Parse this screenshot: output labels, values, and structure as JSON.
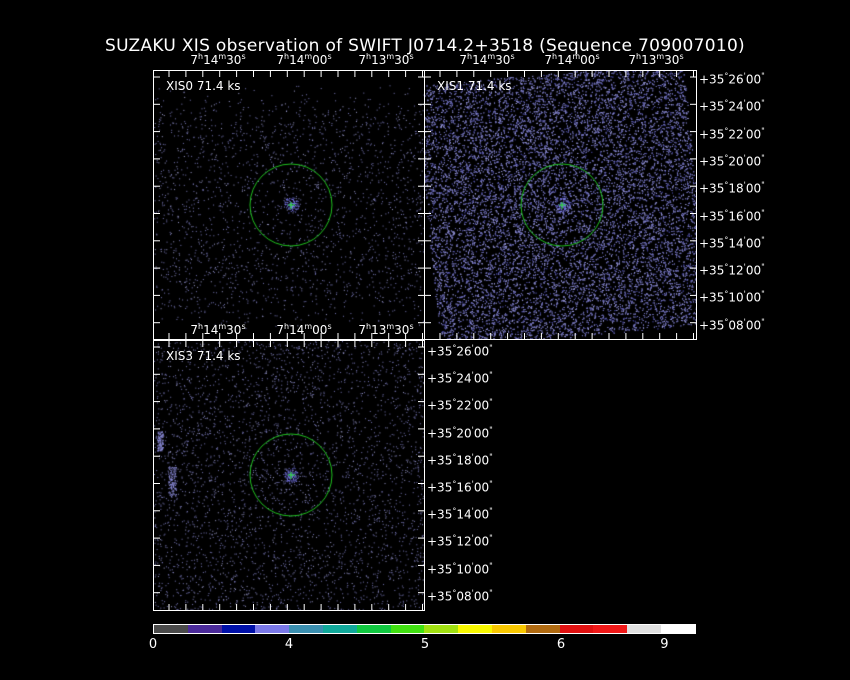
{
  "title": "SUZAKU XIS observation of SWIFT J0714.2+3518  (Sequence 709007010)",
  "panels": [
    {
      "id": "xis0",
      "label": "XIS0 71.4 ks",
      "density": "low",
      "has_ra_labels": true,
      "has_dec_labels": false
    },
    {
      "id": "xis1",
      "label": "XIS1 71.4 ks",
      "density": "high",
      "has_ra_labels": true,
      "has_dec_labels": true
    },
    {
      "id": "xis3",
      "label": "XIS3 71.4 ks",
      "density": "low",
      "has_ra_labels": false,
      "has_dec_labels": true
    }
  ],
  "ra_labels": [
    {
      "h": "7",
      "m": "14",
      "s": "30"
    },
    {
      "h": "7",
      "m": "14",
      "s": "00"
    },
    {
      "h": "7",
      "m": "13",
      "s": "30"
    }
  ],
  "dec_labels": [
    {
      "deg": "+35",
      "min": "26",
      "sec": "00"
    },
    {
      "deg": "+35",
      "min": "24",
      "sec": "00"
    },
    {
      "deg": "+35",
      "min": "22",
      "sec": "00"
    },
    {
      "deg": "+35",
      "min": "20",
      "sec": "00"
    },
    {
      "deg": "+35",
      "min": "18",
      "sec": "00"
    },
    {
      "deg": "+35",
      "min": "16",
      "sec": "00"
    },
    {
      "deg": "+35",
      "min": "14",
      "sec": "00"
    },
    {
      "deg": "+35",
      "min": "12",
      "sec": "00"
    },
    {
      "deg": "+35",
      "min": "10",
      "sec": "00"
    },
    {
      "deg": "+35",
      "min": "08",
      "sec": "00"
    }
  ],
  "colorbar": {
    "colors": [
      "#4a4a4a",
      "#4b2a9a",
      "#0010a8",
      "#7a78e8",
      "#3a8fb0",
      "#10a89a",
      "#10c840",
      "#40e010",
      "#a0e010",
      "#f8f800",
      "#f8c800",
      "#b06a10",
      "#e01010",
      "#f01818",
      "#e0e0e0",
      "#ffffff"
    ],
    "labels": [
      {
        "text": "0",
        "frac": 0.0
      },
      {
        "text": "4",
        "frac": 0.25
      },
      {
        "text": "5",
        "frac": 0.5
      },
      {
        "text": "6",
        "frac": 0.75
      },
      {
        "text": "9",
        "frac": 0.94
      }
    ]
  },
  "colors": {
    "background": "#000000",
    "photon": "#8080c0",
    "circle": "#20c020",
    "cross": "#20e020"
  }
}
